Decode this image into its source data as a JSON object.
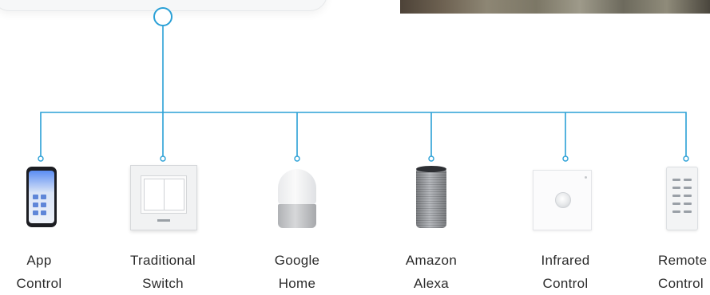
{
  "colors": {
    "connector": "#2aa0d6",
    "label": "#2c2c2c"
  },
  "devices": [
    {
      "label_line1": "App",
      "label_line2": "Control",
      "icon": "smartphone-app-icon"
    },
    {
      "label_line1": "Traditional",
      "label_line2": "Switch",
      "icon": "wall-switch-icon"
    },
    {
      "label_line1": "Google",
      "label_line2": "Home",
      "icon": "google-home-speaker-icon"
    },
    {
      "label_line1": "Amazon",
      "label_line2": "Alexa",
      "icon": "amazon-echo-speaker-icon"
    },
    {
      "label_line1": "Infrared",
      "label_line2": "Control",
      "icon": "infrared-sensor-icon"
    },
    {
      "label_line1": "Remote",
      "label_line2": "Control",
      "icon": "remote-control-icon"
    }
  ]
}
